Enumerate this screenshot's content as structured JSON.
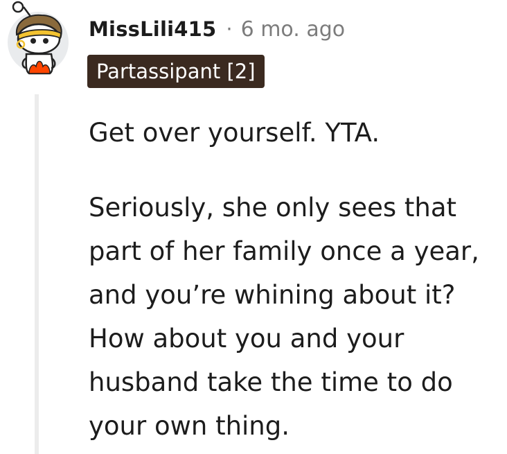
{
  "comment": {
    "username": "MissLili415",
    "separator": "·",
    "timestamp": "6 mo. ago",
    "flair": "Partassipant [2]",
    "paragraphs": [
      "Get over yourself. YTA.",
      "Seriously, she only sees that part of her family once a year, and you’re whining about it? How about you and your husband take the time to do your own thing."
    ]
  },
  "colors": {
    "flair_bg": "#3b2a20",
    "flair_text": "#ffffff",
    "text": "#1c1c1c",
    "meta": "#7c7c7c",
    "thread_line": "#ececec",
    "avatar_bg": "#e9ebed",
    "avatar_accent": "#ff4500",
    "avatar_band": "#f2c230"
  },
  "icons": {
    "avatar": "reddit-snoo-avatar-icon"
  }
}
